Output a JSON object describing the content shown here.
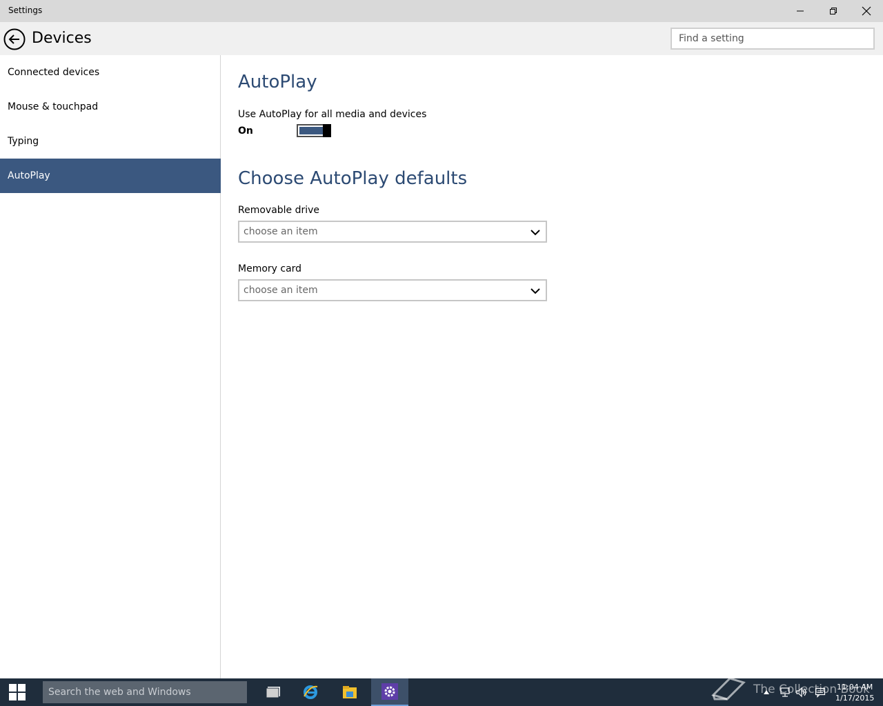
{
  "window": {
    "title": "Settings"
  },
  "header": {
    "title": "Devices",
    "search_placeholder": "Find a setting"
  },
  "sidebar": {
    "items": [
      {
        "label": "Connected devices",
        "active": false
      },
      {
        "label": "Mouse & touchpad",
        "active": false
      },
      {
        "label": "Typing",
        "active": false
      },
      {
        "label": "AutoPlay",
        "active": true
      }
    ]
  },
  "main": {
    "heading": "AutoPlay",
    "toggle": {
      "label": "Use AutoPlay for all media and devices",
      "state_text": "On",
      "on": true
    },
    "defaults_heading": "Choose AutoPlay defaults",
    "fields": [
      {
        "label": "Removable drive",
        "value": "choose an item"
      },
      {
        "label": "Memory card",
        "value": "choose an item"
      }
    ]
  },
  "taskbar": {
    "search_placeholder": "Search the web and Windows",
    "watermark": "The Collection Book",
    "time": "11:04 AM",
    "date": "1/17/2015"
  },
  "colors": {
    "accent": "#3b5880",
    "heading": "#2c4a73",
    "taskbar": "#1f2d3c"
  }
}
